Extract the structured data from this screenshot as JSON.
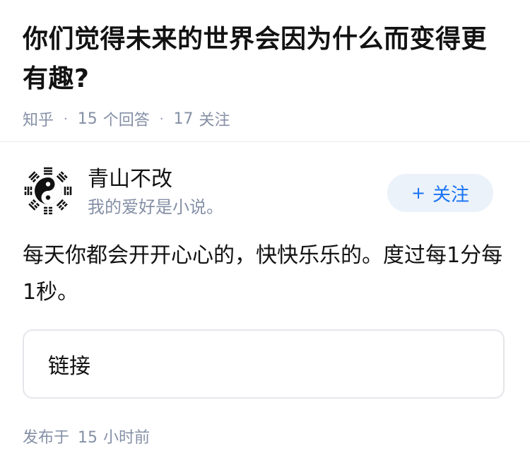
{
  "question": {
    "title": "你们觉得未来的世界会因为什么而变得更有趣?",
    "source": "知乎",
    "answer_count": "15",
    "answer_label": "个回答",
    "follow_count": "17",
    "follow_label": "关注"
  },
  "author": {
    "name": "青山不改",
    "bio": "我的爱好是小说。",
    "avatar_icon": "yin-yang-bagua-icon",
    "follow_button": {
      "icon": "plus-icon",
      "plus": "+",
      "label": "关注"
    }
  },
  "answer": {
    "text": "每天你都会开开心心的，快快乐乐的。度过每1分每1秒。",
    "link_card_label": "链接",
    "published_prefix": "发布于",
    "published_time_value": "15",
    "published_time_unit": "小时前"
  },
  "colors": {
    "text_primary": "#121212",
    "text_secondary": "#8590a6",
    "accent": "#1772f6",
    "follow_bg": "#ebf2fa",
    "border": "#e4e6ea"
  }
}
